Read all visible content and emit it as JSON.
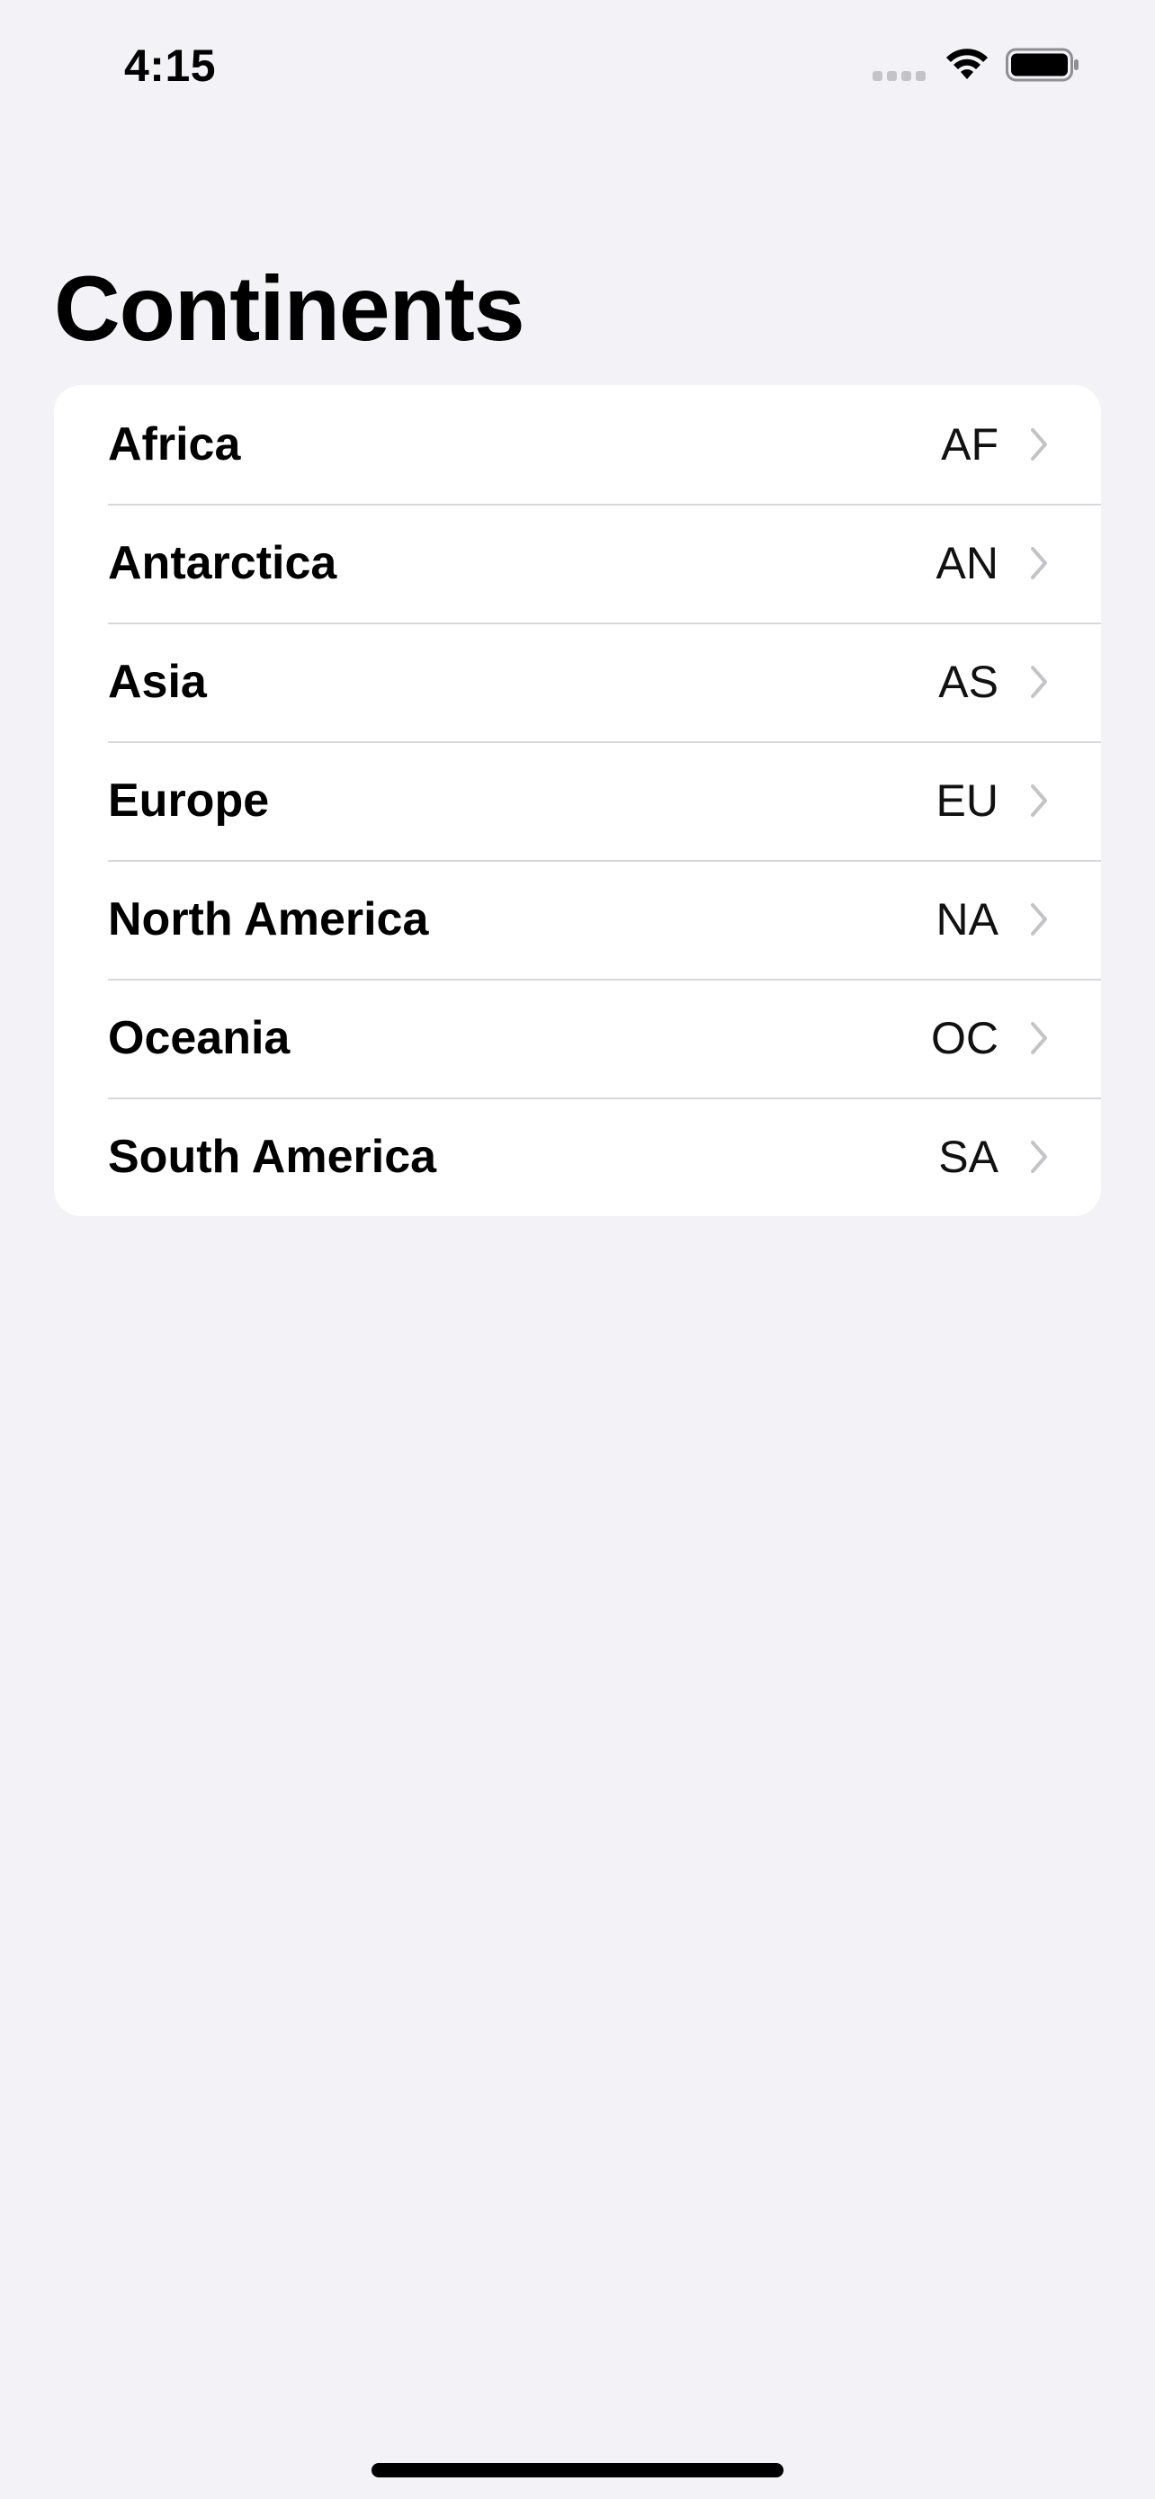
{
  "status_bar": {
    "time": "4:15"
  },
  "page": {
    "title": "Continents"
  },
  "continents": [
    {
      "name": "Africa",
      "code": "AF"
    },
    {
      "name": "Antarctica",
      "code": "AN"
    },
    {
      "name": "Asia",
      "code": "AS"
    },
    {
      "name": "Europe",
      "code": "EU"
    },
    {
      "name": "North America",
      "code": "NA"
    },
    {
      "name": "Oceania",
      "code": "OC"
    },
    {
      "name": "South America",
      "code": "SA"
    }
  ],
  "icons": {
    "signal": "cellular-signal-icon",
    "wifi": "wifi-icon",
    "battery": "battery-icon",
    "row_disclosure": "chevron-right-icon"
  },
  "colors": {
    "background": "#f2f2f7",
    "card": "#ffffff",
    "separator": "#d8d8dc",
    "chevron": "#c4c4c8"
  }
}
